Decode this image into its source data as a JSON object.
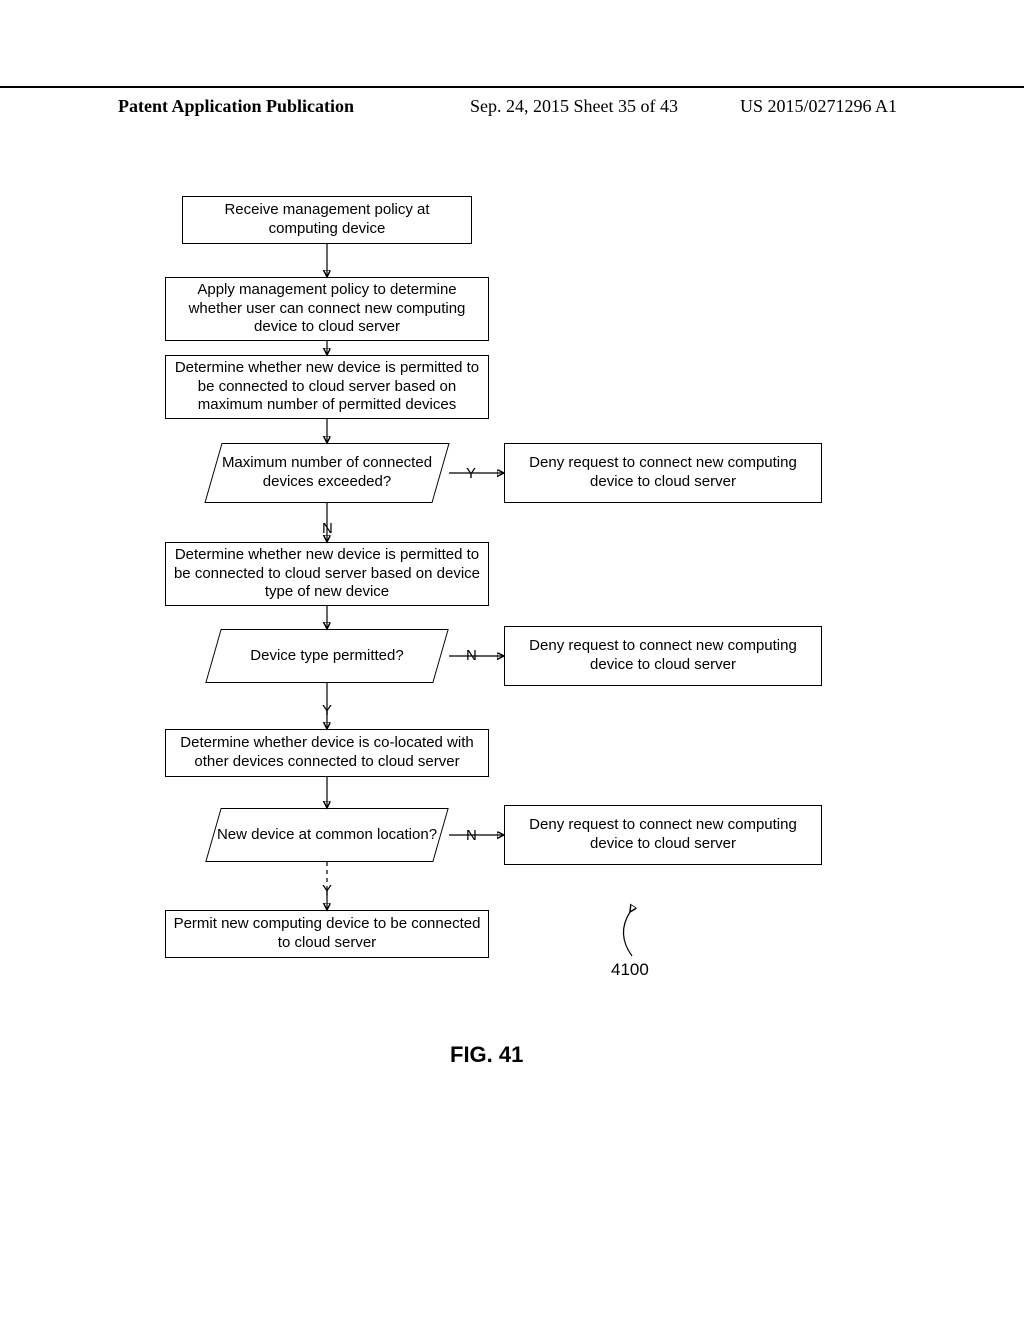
{
  "header": {
    "left": "Patent Application Publication",
    "center": "Sep. 24, 2015  Sheet 35 of 43",
    "right": "US 2015/0271296 A1"
  },
  "flow": {
    "step1": "Receive management policy at computing device",
    "step2": "Apply management policy to determine whether user can connect new computing device to cloud server",
    "step3": "Determine whether new device is permitted to be connected to cloud server based on maximum number of permitted devices",
    "dec1": "Maximum number of connected devices exceeded?",
    "deny1": "Deny request to connect new computing device to cloud server",
    "step4": "Determine whether new device is permitted to be connected to cloud server based on device type of new device",
    "dec2": "Device type permitted?",
    "deny2": "Deny request to connect new computing device to cloud server",
    "step5": "Determine whether device is co-located with other devices connected to cloud server",
    "dec3": "New device at common location?",
    "deny3": "Deny request to connect new computing device to cloud server",
    "step6": "Permit new computing device to be connected to cloud server",
    "y": "Y",
    "n": "N",
    "ref": "4100"
  },
  "figure_label": "FIG. 41"
}
